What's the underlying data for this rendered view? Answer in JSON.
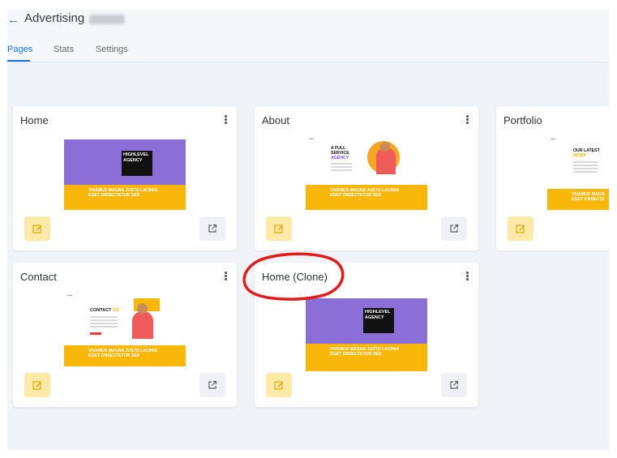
{
  "header": {
    "back_icon": "arrow-left-icon",
    "title": "Advertising"
  },
  "tabs": [
    {
      "label": "Pages",
      "active": true
    },
    {
      "label": "Stats",
      "active": false
    },
    {
      "label": "Settings",
      "active": false
    }
  ],
  "cards": [
    {
      "title": "Home",
      "preview": {
        "headline": [
          "HIGHLEVEL",
          "AGENCY"
        ],
        "band_text": [
          "VIVAMUS MAGNA JUSTO LACINIA",
          "EGET ONSECTETUR SED"
        ]
      }
    },
    {
      "title": "About",
      "preview": {
        "headline": [
          "A FULL",
          "SERVICE",
          "AGENCY"
        ],
        "band_text": [
          "VIVAMUS MAGNA JUSTO LACINIA",
          "EGET ONSECTETUR SED"
        ]
      }
    },
    {
      "title": "Portfolio",
      "preview": {
        "headline": [
          "OUR LATEST",
          "WORK"
        ],
        "band_text": [
          "VIVAMUS MAGN",
          "EGET ONSECTE"
        ]
      }
    },
    {
      "title": "Contact",
      "preview": {
        "headline": [
          "CONTACT",
          "US"
        ],
        "band_text": [
          "VIVAMUS MAGNA JUSTO LACINIA",
          "EGET ONSECTETUR SED"
        ]
      }
    },
    {
      "title": "Home (Clone)",
      "preview": {
        "headline": [
          "HIGHLEVEL",
          "AGENCY"
        ],
        "band_text": [
          "VIVAMUS MAGNA JUSTO LACINIA",
          "EGET ONSECTETUR SED"
        ]
      }
    }
  ],
  "icons": {
    "edit": "edit-icon",
    "open": "external-link-icon",
    "menu": "kebab-menu-icon"
  },
  "colors": {
    "accent": "#1a73e8",
    "edit_button": "#fde9a8",
    "annotation": "#e31b1b",
    "preview_band": "#f9b70a",
    "preview_purple": "#8b6fd6"
  }
}
